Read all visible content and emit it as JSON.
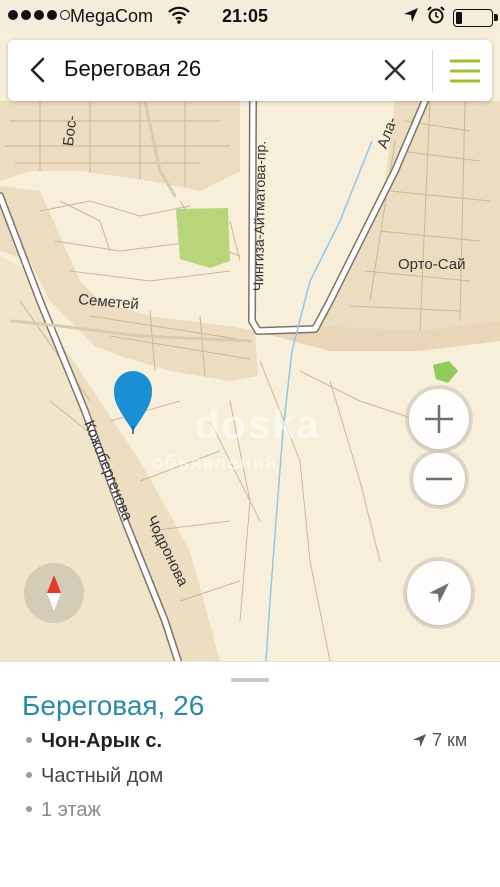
{
  "status_bar": {
    "carrier": "MegaCom",
    "time": "21:05",
    "battery_level": 0.15,
    "signal_bars": 4,
    "icons": [
      "signal-dots-icon",
      "wifi-icon",
      "location-arrow-icon",
      "alarm-icon",
      "battery-icon"
    ]
  },
  "search": {
    "query": "Береговая 26",
    "icons": {
      "back": "chevron-left-icon",
      "clear": "close-icon",
      "menu": "hamburger-menu-icon"
    },
    "menu_color": "#9bbf2e"
  },
  "map": {
    "labels": {
      "bos": "Бос-",
      "ala": "Ала-",
      "aitmatov": "Чингиза-Айтматова-пр.",
      "orto_sai": "Орто-Сай",
      "semetei": "Семетей",
      "kozhoberenova": "Кожобергенова",
      "chodronova": "Чодронова"
    },
    "watermark": {
      "line1": "doska",
      "line2": "объявлений"
    },
    "colors": {
      "background": "#f7efd9",
      "urban": "#ecdcc0",
      "park": "#b7d67a",
      "road": "#ffffff",
      "road_outline": "#8a7f72",
      "stream": "#8ec9e6",
      "marker": "#1b8fd6"
    },
    "controls": {
      "zoom_in": "plus-icon",
      "zoom_out": "minus-icon",
      "locate": "navigation-arrow-icon",
      "compass": "compass-icon"
    }
  },
  "place": {
    "title": "Береговая, 26",
    "locality": "Чон-Арык с.",
    "type": "Частный дом",
    "floors": "1 этаж",
    "distance": "7 км",
    "title_color": "#2b8aa5"
  }
}
